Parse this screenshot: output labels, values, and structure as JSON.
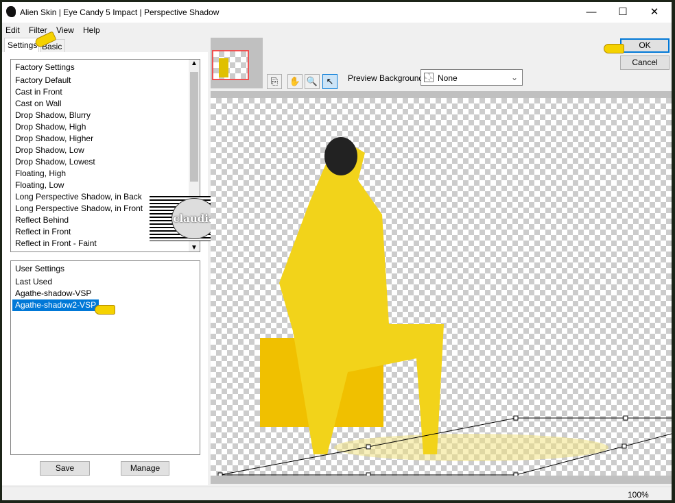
{
  "window": {
    "title": "Alien Skin | Eye Candy 5 Impact | Perspective Shadow",
    "minimize": "—",
    "maximize": "☐",
    "close": "✕"
  },
  "menu": [
    "Edit",
    "Filter",
    "View",
    "Help"
  ],
  "tabs": [
    "Settings",
    "Basic"
  ],
  "factory": {
    "header": "Factory Settings",
    "items": [
      "Factory Default",
      "Cast in Front",
      "Cast on Wall",
      "Drop Shadow, Blurry",
      "Drop Shadow, High",
      "Drop Shadow, Higher",
      "Drop Shadow, Low",
      "Drop Shadow, Lowest",
      "Floating, High",
      "Floating, Low",
      "Long Perspective Shadow, in Back",
      "Long Perspective Shadow, in Front",
      "Reflect Behind",
      "Reflect in Front",
      "Reflect in Front - Faint"
    ]
  },
  "user": {
    "header": "User Settings",
    "items": [
      "Last Used",
      "Agathe-shadow-VSP"
    ],
    "selected": "Agathe-shadow2-VSP"
  },
  "buttons": {
    "save": "Save",
    "manage": "Manage",
    "ok": "OK",
    "cancel": "Cancel"
  },
  "preview": {
    "bg_label": "Preview Background:",
    "bg_value": "None"
  },
  "watermark": "claudia",
  "status": {
    "zoom": "100%"
  },
  "colors": {
    "selection": "#0078d7",
    "thumb_border": "#f05050"
  }
}
